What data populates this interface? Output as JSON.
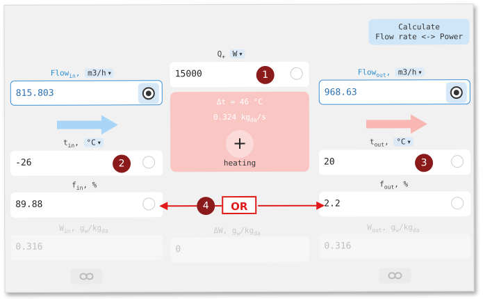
{
  "calc_button": {
    "line1": "Calculate",
    "line2": "Flow rate <-> Power"
  },
  "power": {
    "symbol": "Q",
    "sub": "+",
    "unit": "W",
    "value": "15000"
  },
  "flow_in": {
    "label": "Flow",
    "sub": "in",
    "unit": "m3/h",
    "value": "815.803"
  },
  "flow_out": {
    "label": "Flow",
    "sub": "out",
    "unit": "m3/h",
    "value": "968.63"
  },
  "center": {
    "delta_t": "Δt = 46 °C",
    "kg_value": "0.324 kg",
    "kg_sub": "da",
    "kg_tail": "/s",
    "mode": "heating",
    "plus": "+"
  },
  "t_in": {
    "label": "t",
    "sub": "in",
    "unit": "°C",
    "value": "-26"
  },
  "t_out": {
    "label": "t",
    "sub": "out",
    "unit": "°C",
    "value": "20"
  },
  "f_in": {
    "label": "f",
    "sub": "in",
    "unit": "%",
    "value": "89.88"
  },
  "f_out": {
    "label": "f",
    "sub": "out",
    "unit": "%",
    "value": "2.2"
  },
  "w_in": {
    "label": "W",
    "sub": "in",
    "unit_a": "g",
    "unit_a_sub": "w",
    "unit_b": "/kg",
    "unit_b_sub": "da",
    "value": "0.316"
  },
  "w_delta": {
    "label": "ΔW,",
    "unit_a": "g",
    "unit_a_sub": "w",
    "unit_b": "/kg",
    "unit_b_sub": "da",
    "value": "0"
  },
  "w_out": {
    "label": "W",
    "sub": "out",
    "unit_a": "g",
    "unit_a_sub": "w",
    "unit_b": "/kg",
    "unit_b_sub": "da",
    "value": "0.316"
  },
  "badges": [
    "1",
    "2",
    "3",
    "4"
  ],
  "or_label": "OR",
  "colors": {
    "accent": "#3a8fd9",
    "badge": "#8b1a1a",
    "annotation": "#e01b1b",
    "card": "#f9c6c3"
  }
}
